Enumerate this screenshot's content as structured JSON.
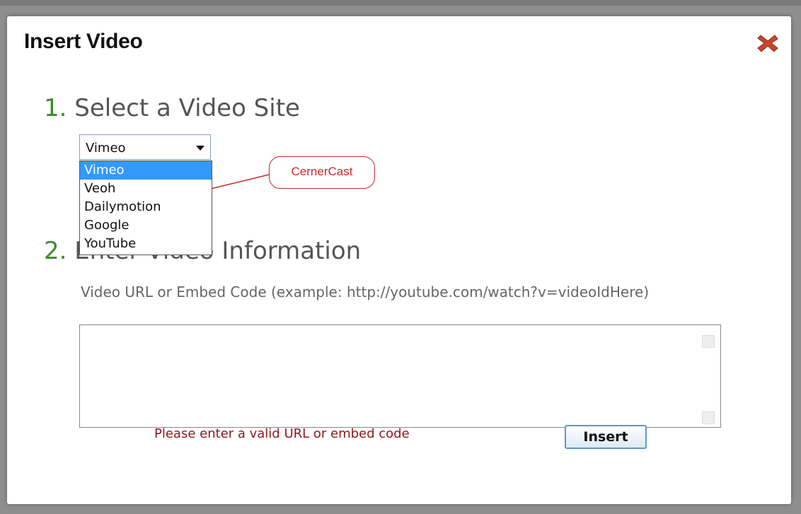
{
  "dialog": {
    "title": "Insert Video",
    "close_icon": "close-x-icon"
  },
  "step1": {
    "number": "1.",
    "title": "Select a Video Site"
  },
  "video_site_select": {
    "selected_value": "Vimeo",
    "options": [
      "Vimeo",
      "Veoh",
      "Dailymotion",
      "Google",
      "YouTube"
    ],
    "highlighted_index": 0
  },
  "callout": {
    "text": "CernerCast"
  },
  "step2": {
    "number": "2.",
    "title": "Enter Video Information"
  },
  "video_field": {
    "label": "Video URL or Embed Code (example: http://youtube.com/watch?v=videoIdHere)",
    "value": ""
  },
  "validation": {
    "error_message": "Please enter a valid URL or embed code"
  },
  "actions": {
    "insert_label": "Insert"
  },
  "colors": {
    "step_number": "#3b8a2e",
    "heading": "#555555",
    "error": "#8b1a1a",
    "callout": "#c82a2a",
    "selection": "#3399ff"
  }
}
